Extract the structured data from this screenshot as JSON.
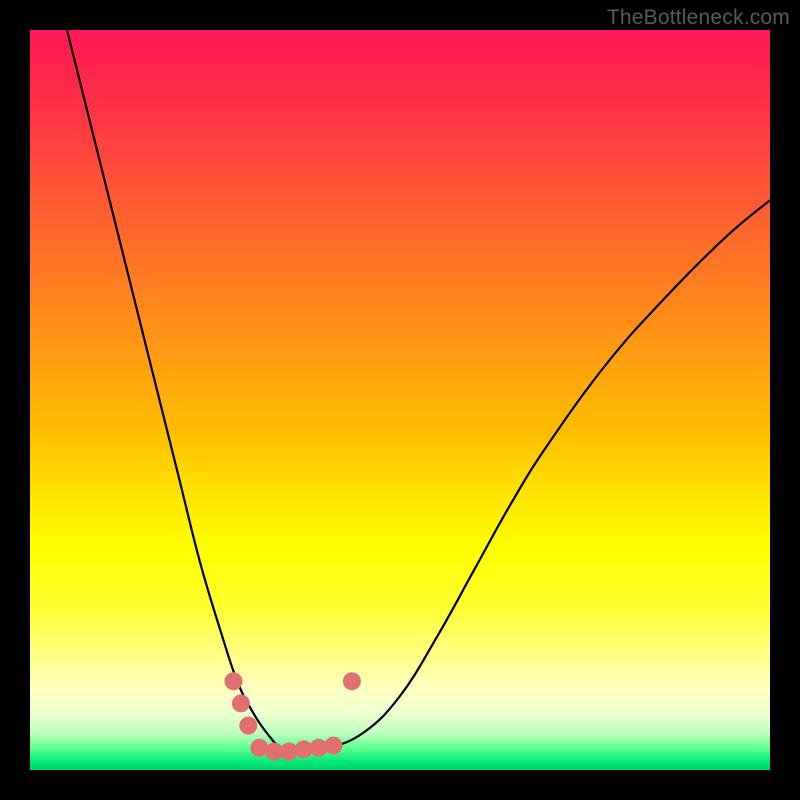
{
  "watermark": "TheBottleneck.com",
  "chart_data": {
    "type": "line",
    "title": "",
    "xlabel": "",
    "ylabel": "",
    "xlim": [
      0,
      100
    ],
    "ylim": [
      0,
      100
    ],
    "grid": false,
    "legend": false,
    "series": [
      {
        "name": "bottleneck-curve",
        "x": [
          5,
          8,
          12,
          16,
          20,
          23,
          26,
          28,
          30,
          32,
          34,
          36,
          40,
          45,
          50,
          55,
          60,
          65,
          70,
          78,
          86,
          94,
          100
        ],
        "y": [
          100,
          88,
          72,
          56,
          40,
          28,
          18,
          12,
          8,
          5,
          3,
          3,
          3,
          5,
          10,
          18,
          27,
          36,
          44,
          55,
          64,
          72,
          77
        ],
        "color": "#000000",
        "stroke_width": 2
      }
    ],
    "markers": {
      "name": "highlight-points",
      "color": "#e07070",
      "radius": 9,
      "points": [
        {
          "x": 27.5,
          "y": 12
        },
        {
          "x": 28.5,
          "y": 9
        },
        {
          "x": 29.5,
          "y": 6
        },
        {
          "x": 31,
          "y": 3
        },
        {
          "x": 33,
          "y": 2.5
        },
        {
          "x": 35,
          "y": 2.5
        },
        {
          "x": 37,
          "y": 2.8
        },
        {
          "x": 39,
          "y": 3.0
        },
        {
          "x": 41,
          "y": 3.3
        },
        {
          "x": 43.5,
          "y": 12
        }
      ]
    },
    "background_gradient": {
      "top": "#ff1a55",
      "upper_mid": "#ffc000",
      "lower_mid": "#ffff60",
      "bottom": "#00d878"
    }
  }
}
